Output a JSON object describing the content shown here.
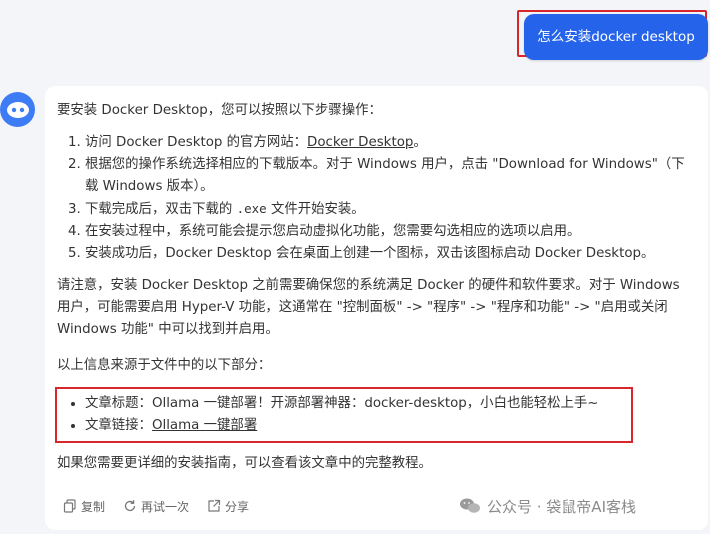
{
  "user_message": "怎么安装docker desktop",
  "intro": "要安装 Docker Desktop，您可以按照以下步骤操作：",
  "steps": {
    "s1_prefix": "访问 Docker Desktop 的官方网站：",
    "s1_link": "Docker Desktop",
    "s1_suffix": "。",
    "s2": "根据您的操作系统选择相应的下载版本。对于 Windows 用户，点击 \"Download for Windows\"（下载 Windows 版本）。",
    "s3_prefix": "下载完成后，双击下载的",
    "s3_code": ".exe",
    "s3_suffix": "文件开始安装。",
    "s4": "在安装过程中，系统可能会提示您启动虚拟化功能，您需要勾选相应的选项以启用。",
    "s5": "安装成功后，Docker Desktop 会在桌面上创建一个图标，双击该图标启动 Docker Desktop。"
  },
  "note": "请注意，安装 Docker Desktop 之前需要确保您的系统满足 Docker 的硬件和软件要求。对于 Windows 用户，可能需要启用 Hyper-V 功能，这通常在 \"控制面板\" -> \"程序\" -> \"程序和功能\" -> \"启用或关闭 Windows 功能\" 中可以找到并启用。",
  "source_intro": "以上信息来源于文件中的以下部分：",
  "sources": {
    "title_label": "文章标题：",
    "title_value": "Ollama 一键部署！开源部署神器：docker-desktop，小白也能轻松上手~",
    "link_label": "文章链接：",
    "link_value": "Ollama 一键部署"
  },
  "closing": "如果您需要更详细的安装指南，可以查看该文章中的完整教程。",
  "actions": {
    "copy": "复制",
    "retry": "再试一次",
    "share": "分享"
  },
  "watermark": "公众号 · 袋鼠帝AI客栈",
  "colors": {
    "user_bubble": "#2563eb",
    "highlight_border": "#d9262c",
    "avatar": "#3d7cf4"
  }
}
